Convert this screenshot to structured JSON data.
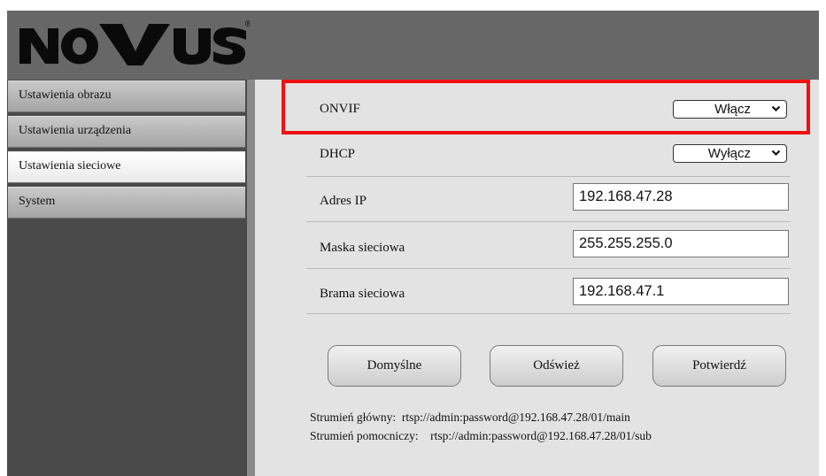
{
  "brand": {
    "logo_text": "NOVUS",
    "registered_mark": "®"
  },
  "sidebar": {
    "items": [
      {
        "label": "Ustawienia obrazu",
        "active": false
      },
      {
        "label": "Ustawienia urządzenia",
        "active": false
      },
      {
        "label": "Ustawienia sieciowe",
        "active": true
      },
      {
        "label": "System",
        "active": false
      }
    ]
  },
  "network": {
    "onvif": {
      "label": "ONVIF",
      "value": "Włącz"
    },
    "dhcp": {
      "label": "DHCP",
      "value": "Wyłącz"
    },
    "ip_address": {
      "label": "Adres IP",
      "value": "192.168.47.28"
    },
    "netmask": {
      "label": "Maska sieciowa",
      "value": "255.255.255.0"
    },
    "gateway": {
      "label": "Brama sieciowa",
      "value": "192.168.47.1"
    }
  },
  "buttons": {
    "default_label": "Domyślne",
    "refresh_label": "Odśwież",
    "confirm_label": "Potwierdź"
  },
  "streams": {
    "main_label": "Strumień główny:",
    "main_url": "rtsp://admin:password@192.168.47.28/01/main",
    "sub_label": "Strumień pomocniczy:",
    "sub_url": "rtsp://admin:password@192.168.47.28/01/sub"
  },
  "colors": {
    "highlight": "#ee1111",
    "content_bg": "#e3e3e3",
    "header_bg": "#676767",
    "sidebar_bg": "#4a4a4a"
  }
}
